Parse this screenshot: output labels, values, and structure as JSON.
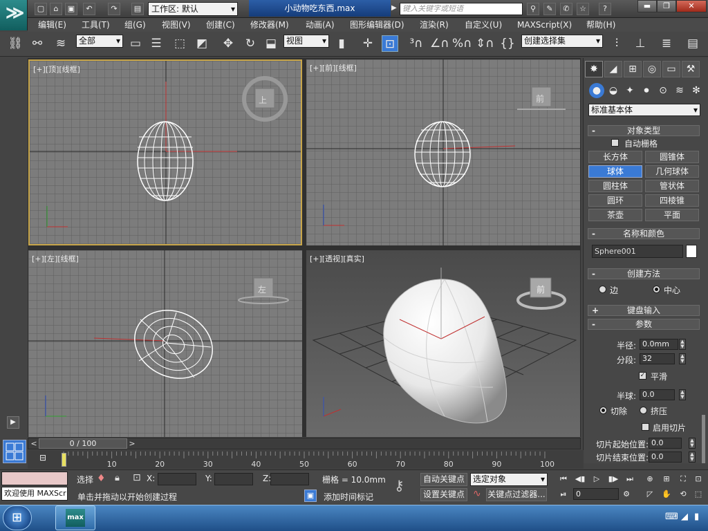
{
  "titlebar": {
    "workspace": "工作区: 默认",
    "doc_title": "小动物吃东西.max",
    "search_placeholder": "键入关键字或短语",
    "win_min": "▬",
    "win_max": "❐",
    "win_close": "✕"
  },
  "menu": [
    "编辑(E)",
    "工具(T)",
    "组(G)",
    "视图(V)",
    "创建(C)",
    "修改器(M)",
    "动画(A)",
    "图形编辑器(D)",
    "渲染(R)",
    "自定义(U)",
    "MAXScript(X)",
    "帮助(H)"
  ],
  "toolbar": {
    "filter_select": "全部",
    "coord_select": "视图",
    "selection_set": "创建选择集"
  },
  "viewports": {
    "top": "[+][顶][线框]",
    "front": "[+][前][线框]",
    "left": "[+][左][线框]",
    "persp": "[+][透视][真实]",
    "cube_top": "上",
    "cube_front": "前",
    "cube_left": "左",
    "cube_persp": "前"
  },
  "command_panel": {
    "primitive_type": "标准基本体",
    "object_type": {
      "title": "对象类型",
      "autogrid": "自动栅格",
      "buttons": [
        "长方体",
        "圆锥体",
        "球体",
        "几何球体",
        "圆柱体",
        "管状体",
        "圆环",
        "四棱锥",
        "茶壶",
        "平面"
      ],
      "active": "球体"
    },
    "name_color": {
      "title": "名称和颜色",
      "name": "Sphere001"
    },
    "creation_method": {
      "title": "创建方法",
      "edge": "边",
      "center": "中心"
    },
    "keyboard_entry": "键盘输入",
    "parameters": {
      "title": "参数",
      "radius_label": "半径:",
      "radius": "0.0mm",
      "segments_label": "分段:",
      "segments": "32",
      "smooth": "平滑",
      "hemisphere_label": "半球:",
      "hemisphere": "0.0",
      "chop": "切除",
      "squash": "挤压",
      "enable_slice": "启用切片",
      "slice_from_label": "切片起始位置:",
      "slice_from": "0.0",
      "slice_to_label": "切片结束位置:",
      "slice_to": "0.0"
    }
  },
  "timeline": {
    "frame_display": "0 / 100",
    "ticks": [
      "10",
      "20",
      "30",
      "40",
      "50",
      "60",
      "70",
      "80",
      "90",
      "100"
    ]
  },
  "status": {
    "maxscript_text": "欢迎使用 MAXScr",
    "selection_label": "选择",
    "x_label": "X:",
    "y_label": "Y:",
    "z_label": "Z:",
    "grid": "栅格 = 10.0mm",
    "prompt": "单击并拖动以开始创建过程",
    "add_time_tag": "添加时间标记",
    "auto_key": "自动关键点",
    "selected_object": "选定对象",
    "set_key": "设置关键点",
    "key_filters": "关键点过滤器...",
    "frame": "0"
  }
}
